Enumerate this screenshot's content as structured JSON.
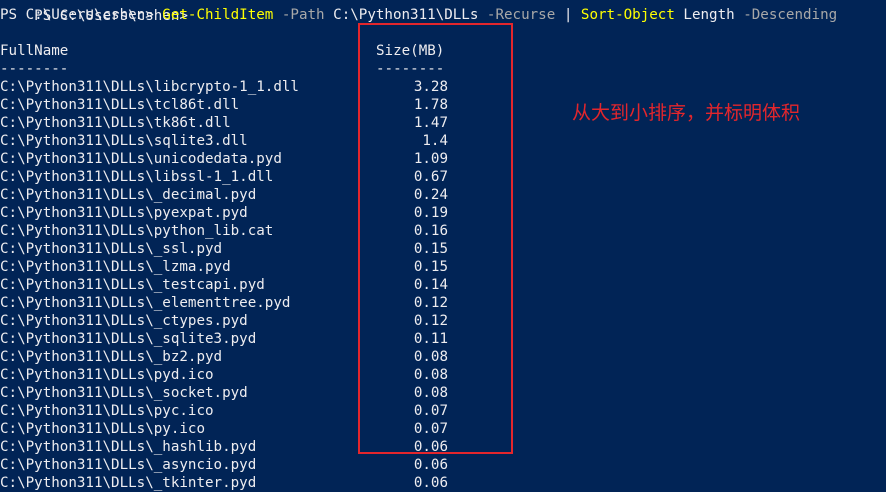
{
  "terminal": {
    "top_cut_text": "PS C:\\Users\\cshen> ",
    "prompt": "PS C:\\Users\\cshen> ",
    "command": {
      "cmdlet1": "Get-ChildItem",
      "param_path": "-Path",
      "path_value": "C:\\Python311\\DLLs",
      "param_recurse": "-Recurse",
      "pipe": "|",
      "cmdlet2": "Sort-Object",
      "sort_prop": "Length",
      "param_desc": "-Descending"
    },
    "columns": {
      "fullname_header": "FullName",
      "fullname_underline": "--------",
      "size_header": "Size(MB)",
      "size_underline": "--------"
    },
    "rows": [
      {
        "name": "C:\\Python311\\DLLs\\libcrypto-1_1.dll",
        "size": "3.28"
      },
      {
        "name": "C:\\Python311\\DLLs\\tcl86t.dll",
        "size": "1.78"
      },
      {
        "name": "C:\\Python311\\DLLs\\tk86t.dll",
        "size": "1.47"
      },
      {
        "name": "C:\\Python311\\DLLs\\sqlite3.dll",
        "size": "1.4"
      },
      {
        "name": "C:\\Python311\\DLLs\\unicodedata.pyd",
        "size": "1.09"
      },
      {
        "name": "C:\\Python311\\DLLs\\libssl-1_1.dll",
        "size": "0.67"
      },
      {
        "name": "C:\\Python311\\DLLs\\_decimal.pyd",
        "size": "0.24"
      },
      {
        "name": "C:\\Python311\\DLLs\\pyexpat.pyd",
        "size": "0.19"
      },
      {
        "name": "C:\\Python311\\DLLs\\python_lib.cat",
        "size": "0.16"
      },
      {
        "name": "C:\\Python311\\DLLs\\_ssl.pyd",
        "size": "0.15"
      },
      {
        "name": "C:\\Python311\\DLLs\\_lzma.pyd",
        "size": "0.15"
      },
      {
        "name": "C:\\Python311\\DLLs\\_testcapi.pyd",
        "size": "0.14"
      },
      {
        "name": "C:\\Python311\\DLLs\\_elementtree.pyd",
        "size": "0.12"
      },
      {
        "name": "C:\\Python311\\DLLs\\_ctypes.pyd",
        "size": "0.12"
      },
      {
        "name": "C:\\Python311\\DLLs\\_sqlite3.pyd",
        "size": "0.11"
      },
      {
        "name": "C:\\Python311\\DLLs\\_bz2.pyd",
        "size": "0.08"
      },
      {
        "name": "C:\\Python311\\DLLs\\pyd.ico",
        "size": "0.08"
      },
      {
        "name": "C:\\Python311\\DLLs\\_socket.pyd",
        "size": "0.08"
      },
      {
        "name": "C:\\Python311\\DLLs\\pyc.ico",
        "size": "0.07"
      },
      {
        "name": "C:\\Python311\\DLLs\\py.ico",
        "size": "0.07"
      },
      {
        "name": "C:\\Python311\\DLLs\\_hashlib.pyd",
        "size": "0.06"
      },
      {
        "name": "C:\\Python311\\DLLs\\_asyncio.pyd",
        "size": "0.06"
      },
      {
        "name": "C:\\Python311\\DLLs\\_tkinter.pyd",
        "size": "0.06"
      }
    ]
  },
  "annotation": {
    "text": "从大到小排序，并标明体积"
  },
  "colors": {
    "background": "#012456",
    "text": "#eeedf0",
    "cmdlet": "#ffff00",
    "parameter": "#a8a8a8",
    "annotation": "#e3262c"
  }
}
